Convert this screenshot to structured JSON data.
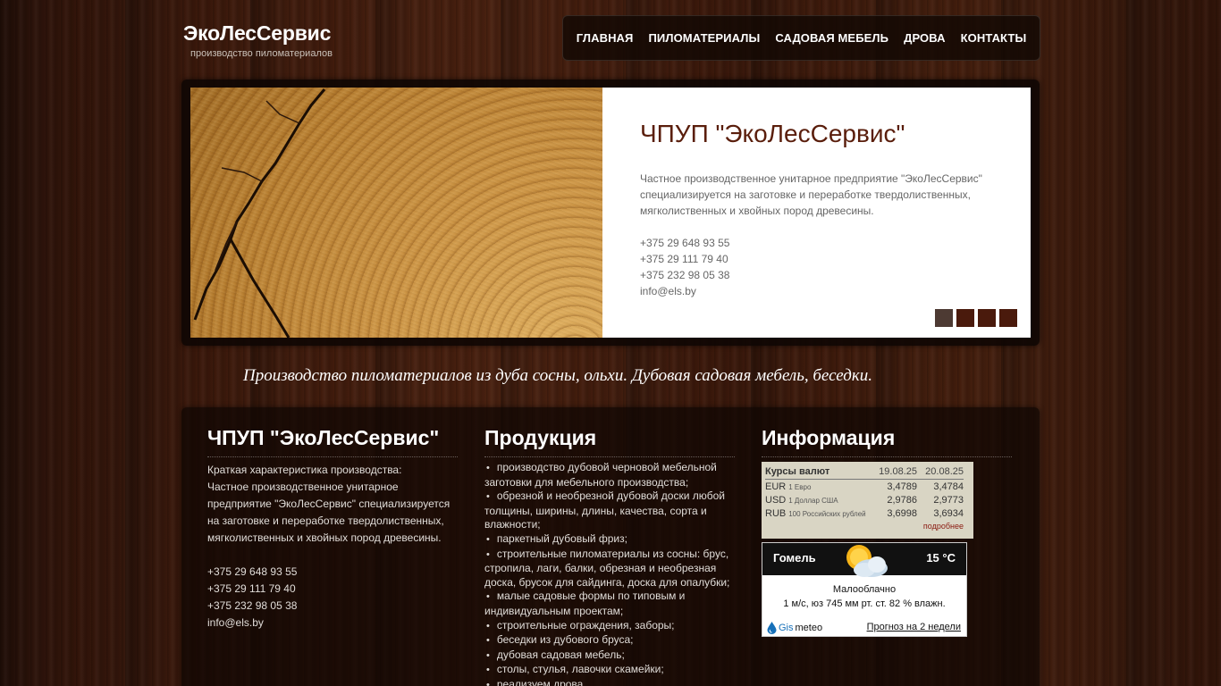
{
  "header": {
    "site_title": "ЭкоЛесСервис",
    "tagline": "производство пиломатериалов"
  },
  "nav": {
    "items": [
      "ГЛАВНАЯ",
      "ПИЛОМАТЕРИАЛЫ",
      "САДОВАЯ МЕБЕЛЬ",
      "ДРОВА",
      "КОНТАКТЫ"
    ]
  },
  "slider": {
    "title": "ЧПУП \"ЭкоЛесСервис\"",
    "description": "Частное производственное унитарное предприятие \"ЭкоЛесСервис\" специализируется на заготовке и переработке твердолиственных, мягколиственных и хвойных пород древесины.",
    "phones": [
      "+375 29 648 93 55",
      "+375 29 111 79 40",
      "+375 232 98 05 38"
    ],
    "email": "info@els.by",
    "slide_count": 4,
    "active_slide": 1
  },
  "main_tagline": "Производство пиломатериалов из дуба сосны, ольхи. Дубовая садовая мебель, беседки.",
  "about": {
    "title": "ЧПУП \"ЭкоЛесСервис\"",
    "intro": "Краткая характеристика производства:",
    "text": "Частное производственное унитарное предприятие \"ЭкоЛесСервис\" специализируется на заготовке и переработке твердолиственных, мягколиственных и хвойных пород древесины.",
    "phones": [
      "+375 29 648 93 55",
      "+375 29 111 79 40",
      "+375 232 98 05 38"
    ],
    "email": "info@els.by"
  },
  "products": {
    "title": "Продукция",
    "items": [
      "производство дубовой черновой мебельной заготовки для мебельного производства;",
      "обрезной и необрезной дубовой доски любой толщины, ширины, длины, качества, сорта и влажности;",
      "паркетный дубовый фриз;",
      "строительные пиломатериалы из сосны: брус, стропила, лаги, балки, обрезная и необрезная доска, брусок для сайдинга, доска для опалубки;",
      "малые садовые формы по типовым и индивидуальным проектам;",
      "строительные ограждения, заборы;",
      "беседки из дубового бруса;",
      "дубовая садовая мебель;",
      "столы, стулья, лавочки скамейки;",
      "реализуем дрова"
    ]
  },
  "info": {
    "title": "Информация",
    "currency": {
      "heading": "Курсы валют",
      "date1": "19.08.25",
      "date2": "20.08.25",
      "rows": [
        {
          "code": "EUR",
          "name": "1 Евро",
          "v1": "3,4789",
          "v2": "3,4784"
        },
        {
          "code": "USD",
          "name": "1 Доллар США",
          "v1": "2,9786",
          "v2": "2,9773"
        },
        {
          "code": "RUB",
          "name": "100 Российских рублей",
          "v1": "3,6998",
          "v2": "3,6934"
        }
      ],
      "more_link": "подробнее"
    },
    "weather": {
      "city": "Гомель",
      "temperature": "15 °C",
      "condition": "Малооблачно",
      "details": "1 м/с, юз 745 мм рт. ст. 82 % влажн.",
      "brand_part1": "Gis",
      "brand_part2": "meteo",
      "forecast_link": "Прогноз на 2 недели"
    }
  },
  "colors": {
    "slide_title": "#5a1e0c",
    "slider_dot": "#4a1a0c",
    "currency_bg": "#d9d5c4"
  }
}
